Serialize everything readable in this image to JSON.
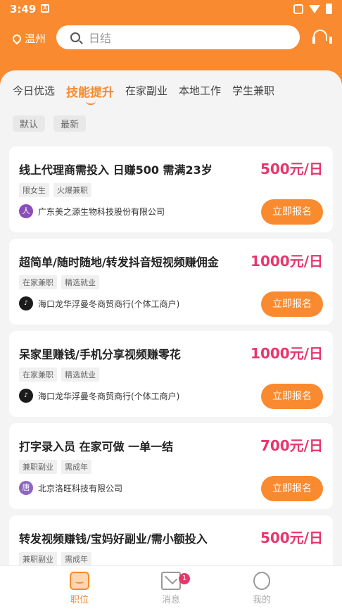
{
  "status_bar": {
    "time": "3:49",
    "sim_label": "A"
  },
  "header": {
    "location": "温州",
    "search_placeholder": "日结"
  },
  "tabs": [
    {
      "label": "今日优选"
    },
    {
      "label": "技能提升"
    },
    {
      "label": "在家副业"
    },
    {
      "label": "本地工作"
    },
    {
      "label": "学生兼职"
    }
  ],
  "sorts": [
    {
      "label": "默认"
    },
    {
      "label": "最新"
    }
  ],
  "jobs": [
    {
      "title": "线上代理商需投入 日赚500 需满23岁",
      "salary": "500元/日",
      "tags": [
        "限女生",
        "火爆兼职"
      ],
      "company": "广东美之源生物科技股份有限公司",
      "logo_text": "人",
      "apply": "立即报名"
    },
    {
      "title": "超简单/随时随地/转发抖音短视频赚佣金",
      "salary": "1000元/日",
      "tags": [
        "在家兼职",
        "精选就业"
      ],
      "company": "海口龙华浮曼冬商贸商行(个体工商户)",
      "logo_text": "♪",
      "apply": "立即报名"
    },
    {
      "title": "呆家里赚钱/手机分享视频赚零花",
      "salary": "1000元/日",
      "tags": [
        "在家兼职",
        "精选就业"
      ],
      "company": "海口龙华浮曼冬商贸商行(个体工商户)",
      "logo_text": "♪",
      "apply": "立即报名"
    },
    {
      "title": "打字录入员 在家可做 一单一结",
      "salary": "700元/日",
      "tags": [
        "兼职副业",
        "需成年"
      ],
      "company": "北京洛旺科技有限公司",
      "logo_text": "唐",
      "apply": "立即报名"
    },
    {
      "title": "转发视频赚钱/宝妈好副业/需小额投入",
      "salary": "500元/日",
      "tags": [
        "兼职副业",
        "需成年"
      ]
    }
  ],
  "navbar": {
    "jobs_label": "职位",
    "messages_label": "消息",
    "messages_badge": "1",
    "me_label": "我的"
  },
  "colors": {
    "accent": "#f98a2f",
    "salary": "#e8366c"
  }
}
